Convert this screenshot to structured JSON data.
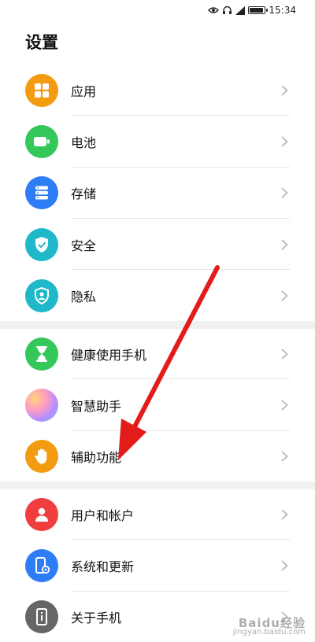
{
  "status": {
    "time": "15:34",
    "battery_level": 0.9
  },
  "page_title": "设置",
  "groups": [
    [
      {
        "label": "应用",
        "icon": "apps-icon",
        "color": "#f39c12"
      },
      {
        "label": "电池",
        "icon": "battery-icon",
        "color": "#34c759"
      },
      {
        "label": "存储",
        "icon": "storage-icon",
        "color": "#2f7df6"
      },
      {
        "label": "安全",
        "icon": "shield-check-icon",
        "color": "#1fb8c9"
      },
      {
        "label": "隐私",
        "icon": "privacy-icon",
        "color": "#1fb8c9"
      }
    ],
    [
      {
        "label": "健康使用手机",
        "icon": "hourglass-icon",
        "color": "#34c759"
      },
      {
        "label": "智慧助手",
        "icon": "assistant-orb-icon",
        "color": "#c9a6ff"
      },
      {
        "label": "辅助功能",
        "icon": "hand-icon",
        "color": "#f39c12"
      }
    ],
    [
      {
        "label": "用户和帐户",
        "icon": "user-icon",
        "color": "#f03e3e"
      },
      {
        "label": "系统和更新",
        "icon": "system-update-icon",
        "color": "#2f7df6"
      },
      {
        "label": "关于手机",
        "icon": "phone-info-icon",
        "color": "#666666"
      }
    ]
  ],
  "watermark": {
    "line1": "Baidu经验",
    "line2": "jingyan.baidu.com"
  },
  "annotation_color": "#e31b1b"
}
